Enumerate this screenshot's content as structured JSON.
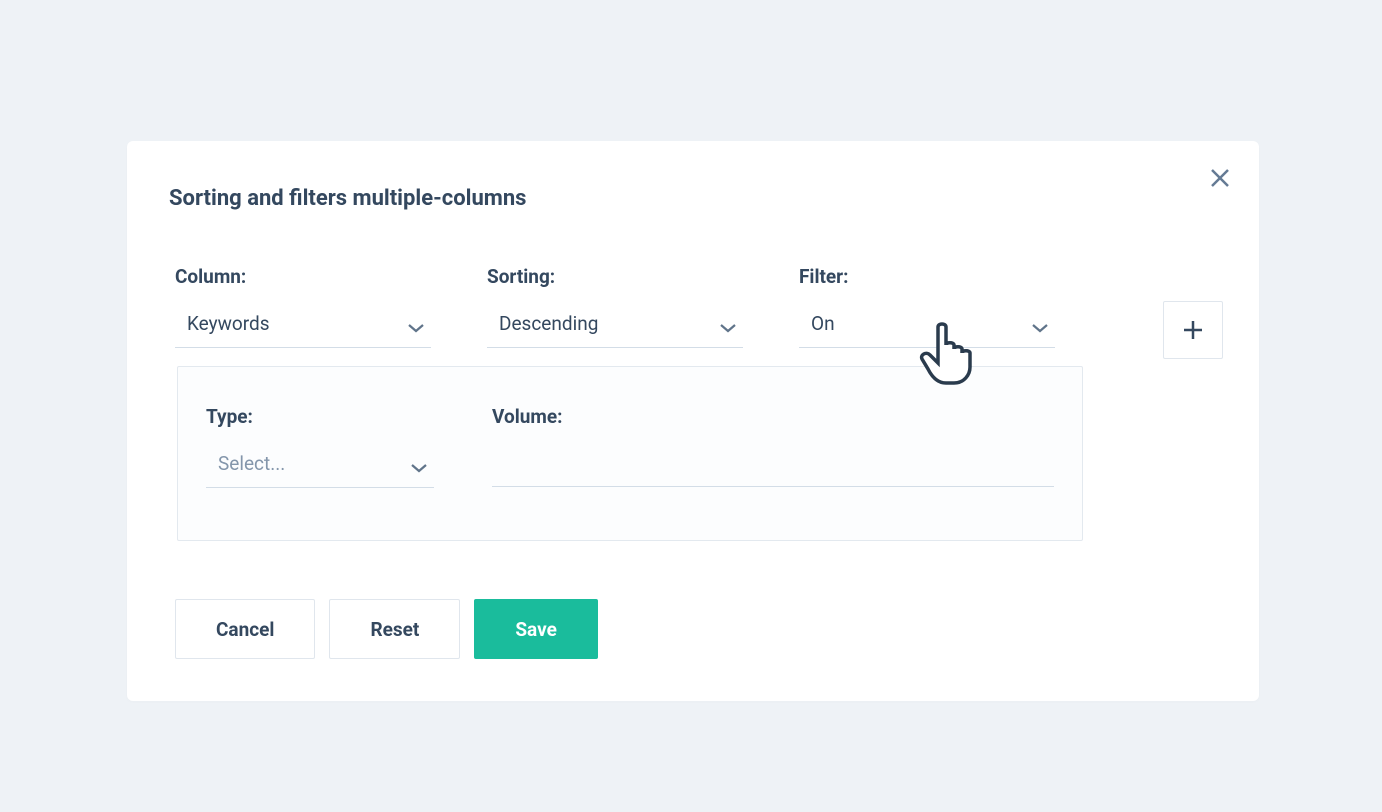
{
  "modal": {
    "title": "Sorting and filters multiple-columns",
    "labels": {
      "column": "Column:",
      "sorting": "Sorting:",
      "filter": "Filter:",
      "type": "Type:",
      "volume": "Volume:"
    },
    "values": {
      "column": "Keywords",
      "sorting": "Descending",
      "filter": "On",
      "type": "Select...",
      "volume": ""
    },
    "buttons": {
      "cancel": "Cancel",
      "reset": "Reset",
      "save": "Save"
    }
  }
}
